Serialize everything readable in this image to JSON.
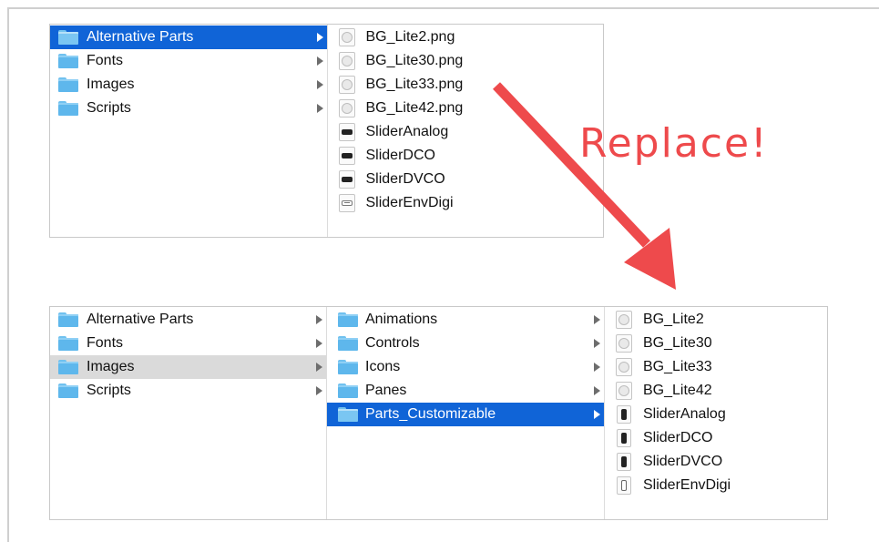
{
  "annotation": {
    "text": "Replace!",
    "color": "#ee4a4c"
  },
  "top_browser": {
    "col1": [
      {
        "label": "Alternative Parts",
        "selected": true
      },
      {
        "label": "Fonts"
      },
      {
        "label": "Images"
      },
      {
        "label": "Scripts"
      }
    ],
    "col2": [
      {
        "label": "BG_Lite2.png",
        "icon": "png-file-icon"
      },
      {
        "label": "BG_Lite30.png",
        "icon": "png-file-icon"
      },
      {
        "label": "BG_Lite33.png",
        "icon": "png-file-icon"
      },
      {
        "label": "BG_Lite42.png",
        "icon": "png-file-icon"
      },
      {
        "label": "SliderAnalog",
        "icon": "slider-file-icon"
      },
      {
        "label": "SliderDCO",
        "icon": "slider-file-icon"
      },
      {
        "label": "SliderDVCO",
        "icon": "slider-file-icon"
      },
      {
        "label": "SliderEnvDigi",
        "icon": "slider-file-light-icon"
      }
    ]
  },
  "bottom_browser": {
    "col1": [
      {
        "label": "Alternative Parts"
      },
      {
        "label": "Fonts"
      },
      {
        "label": "Images",
        "highlighted": true
      },
      {
        "label": "Scripts"
      }
    ],
    "col2": [
      {
        "label": "Animations"
      },
      {
        "label": "Controls"
      },
      {
        "label": "Icons"
      },
      {
        "label": "Panes"
      },
      {
        "label": "Parts_Customizable",
        "selected": true
      }
    ],
    "col3": [
      {
        "label": "BG_Lite2",
        "icon": "png-file-icon"
      },
      {
        "label": "BG_Lite30",
        "icon": "png-file-icon"
      },
      {
        "label": "BG_Lite33",
        "icon": "png-file-icon"
      },
      {
        "label": "BG_Lite42",
        "icon": "png-file-icon"
      },
      {
        "label": "SliderAnalog",
        "icon": "vertical-slider-file-icon"
      },
      {
        "label": "SliderDCO",
        "icon": "vertical-slider-file-icon"
      },
      {
        "label": "SliderDVCO",
        "icon": "vertical-slider-file-icon"
      },
      {
        "label": "SliderEnvDigi",
        "icon": "vertical-slider-light-file-icon"
      }
    ]
  },
  "colors": {
    "selection": "#1064d7",
    "highlight": "#dadada",
    "folder": "#5eb7ec",
    "arrow": "#ee4a4c"
  }
}
